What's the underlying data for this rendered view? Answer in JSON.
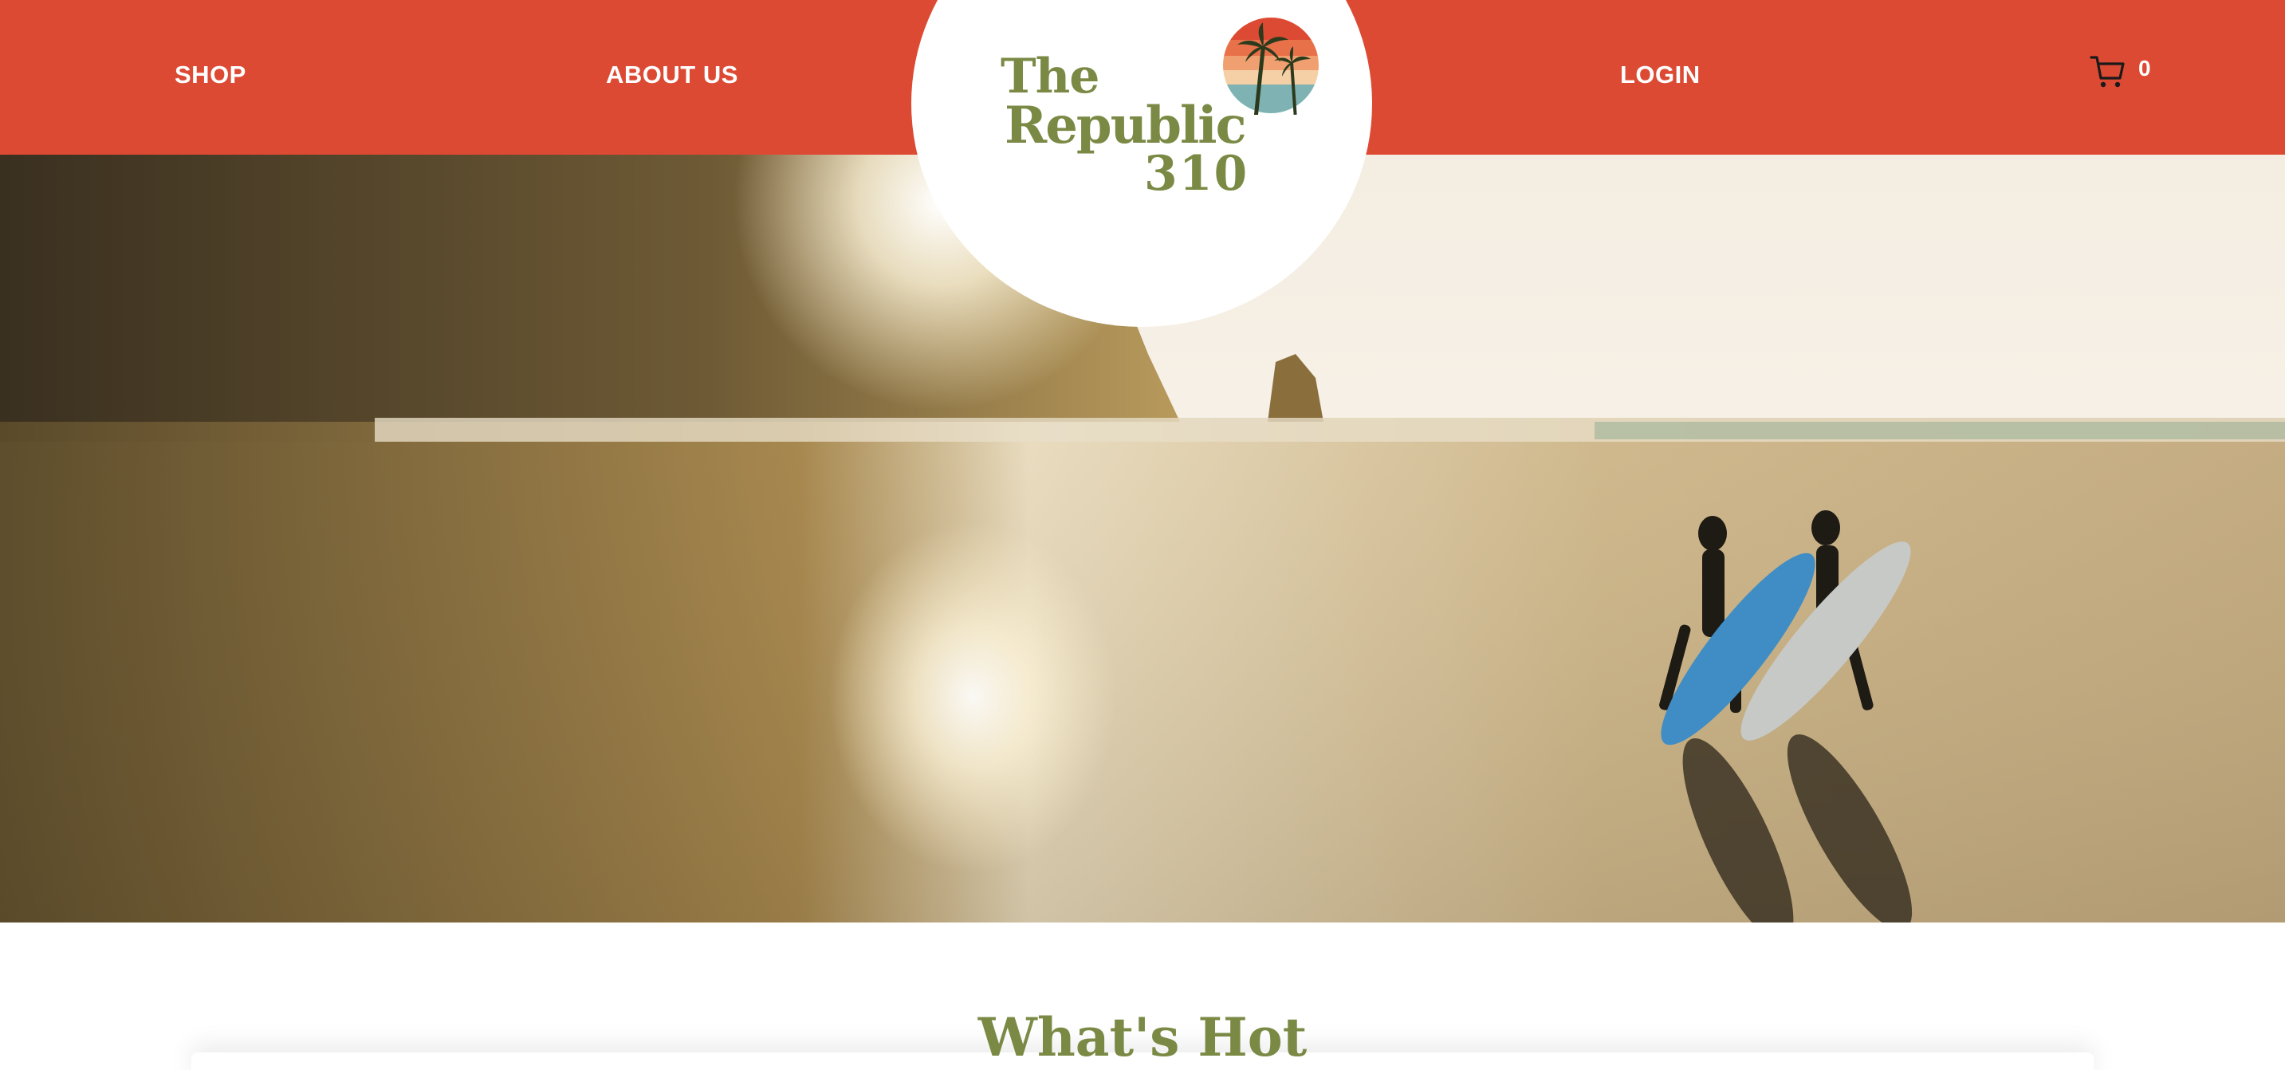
{
  "nav": {
    "shop_label": "SHOP",
    "about_label": "ABOUT US",
    "login_label": "LOGIN",
    "cart_count": "0"
  },
  "brand": {
    "logo_line1": "The",
    "logo_line2": "Republic",
    "logo_line3": "310"
  },
  "sections": {
    "whats_hot_title": "What's Hot"
  },
  "colors": {
    "header_bg": "#dd4a33",
    "brand_green": "#7a8a45"
  },
  "icons": {
    "cart": "shopping-cart-icon"
  }
}
